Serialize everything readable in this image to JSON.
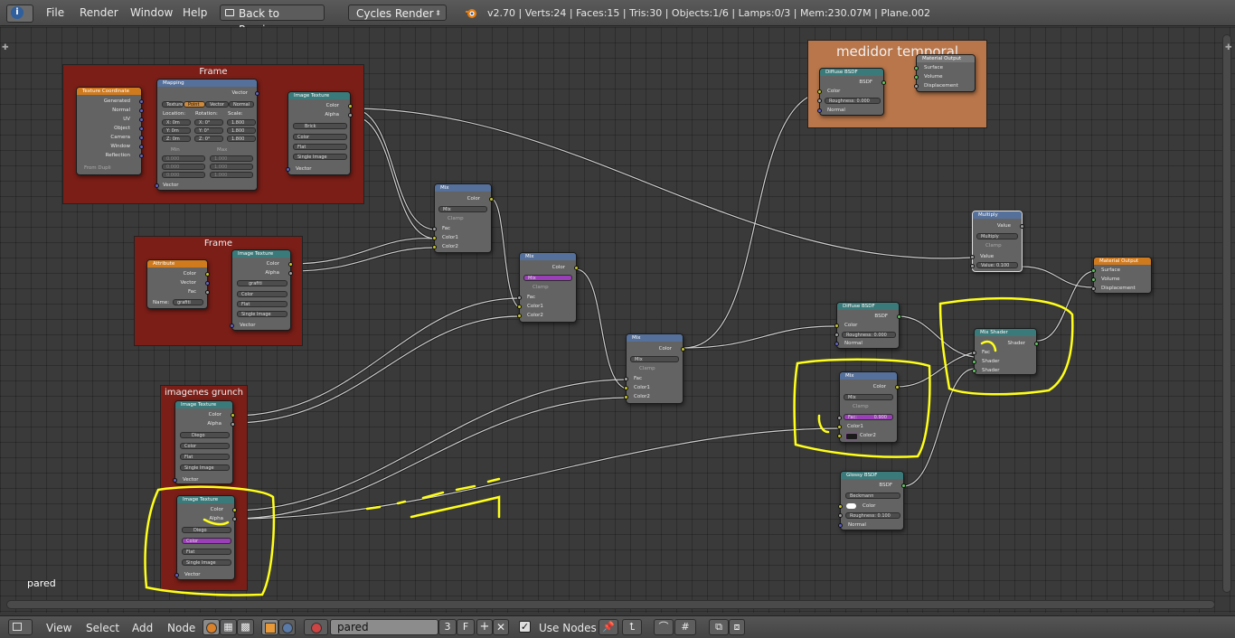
{
  "header": {
    "menus": [
      "File",
      "Render",
      "Window",
      "Help"
    ],
    "back_button": "Back to Previous",
    "engine": "Cycles Render",
    "status": "v2.70 | Verts:24 | Faces:15 | Tris:30 | Objects:1/6 | Lamps:0/3 | Mem:230.07M | Plane.002"
  },
  "editor": {
    "material_label": "pared",
    "frames": [
      {
        "title": "Frame"
      },
      {
        "title": "Frame"
      },
      {
        "title": "imagenes grunch"
      },
      {
        "title": "medidor temporal"
      }
    ],
    "nodes": {
      "texcoord": {
        "title": "Texture Coordinate",
        "outputs": [
          "Generated",
          "Normal",
          "UV",
          "Object",
          "Camera",
          "Window",
          "Reflection"
        ],
        "from_dupli": "From Dupli"
      },
      "mapping": {
        "title": "Mapping",
        "out": "Vector",
        "tabs": [
          "Texture",
          "Point",
          "Vector",
          "Normal"
        ],
        "loc": "Location:",
        "rot": "Rotation:",
        "scale": "Scale:",
        "locs": [
          "X: 0m",
          "Y: 0m",
          "Z: 0m"
        ],
        "rots": [
          "X: 0°",
          "Y: 0°",
          "Z: 0°"
        ],
        "scales": [
          "1.800",
          "1.800",
          "1.800"
        ],
        "min": "Min",
        "max": "Max",
        "mins": [
          "0.000",
          "0.000",
          "0.000"
        ],
        "maxs": [
          "1.000",
          "1.000",
          "1.000"
        ],
        "in": "Vector"
      },
      "imgtex": {
        "title": "Image Texture",
        "color": "Color",
        "alpha": "Alpha",
        "img": "Brick",
        "opt1": "Color",
        "opt2": "Flat",
        "opt3": "Single Image",
        "vector": "Vector"
      },
      "attribute": {
        "title": "Attribute",
        "outputs": [
          "Color",
          "Vector",
          "Fac"
        ],
        "name_label": "Name:",
        "name_val": "grafiti"
      },
      "imgtex2": {
        "title": "Image Texture",
        "color": "Color",
        "alpha": "Alpha",
        "img": "grafiti",
        "opt1": "Color",
        "opt2": "Flat",
        "opt3": "Single Image",
        "vector": "Vector"
      },
      "imgtex3": {
        "title": "Image Texture",
        "color": "Color",
        "alpha": "Alpha",
        "img": "Diego",
        "opt1": "Color",
        "opt2": "Flat",
        "opt3": "Single Image",
        "vector": "Vector"
      },
      "imgtex4": {
        "title": "Image Texture",
        "color": "Color",
        "alpha": "Alpha",
        "img": "Diego",
        "opt1": "Color",
        "opt2": "Flat",
        "opt3": "Single Image",
        "vector": "Vector"
      },
      "mix1": {
        "title": "Mix",
        "out": "Color",
        "mode": "Mix",
        "clamp": "Clamp",
        "fac": "Fac",
        "c1": "Color1",
        "c2": "Color2"
      },
      "mix2": {
        "title": "Mix",
        "out": "Color",
        "mode": "Mix",
        "clamp": "Clamp",
        "fac": "Fac",
        "c1": "Color1",
        "c2": "Color2"
      },
      "mix3": {
        "title": "Mix",
        "out": "Color",
        "mode": "Mix",
        "clamp": "Clamp",
        "fac": "Fac",
        "c1": "Color1",
        "c2": "Color2"
      },
      "mix4": {
        "title": "Mix",
        "out": "Color",
        "mode": "Mix",
        "clamp": "Clamp",
        "fac": "Fac:",
        "fac_val": "0.900",
        "c1": "Color1",
        "c2": "Color2"
      },
      "diffuse1": {
        "title": "Diffuse BSDF",
        "out": "BSDF",
        "color": "Color",
        "rough": "Roughness: 0.000",
        "normal": "Normal"
      },
      "diffuse2": {
        "title": "Diffuse BSDF",
        "out": "BSDF",
        "color": "Color",
        "rough": "Roughness: 0.000",
        "normal": "Normal"
      },
      "glossy": {
        "title": "Glossy BSDF",
        "out": "BSDF",
        "dist": "Beckmann",
        "color": "Color",
        "rough": "Roughness: 0.100",
        "normal": "Normal"
      },
      "mixshader": {
        "title": "Mix Shader",
        "out": "Shader",
        "fac": "Fac",
        "s1": "Shader",
        "s2": "Shader"
      },
      "multiply": {
        "title": "Multiply",
        "out": "Value",
        "mode": "Multiply",
        "clamp": "Clamp",
        "val": "Value",
        "val2": "Value: 0.100"
      },
      "matout1": {
        "title": "Material Output",
        "surface": "Surface",
        "volume": "Volume",
        "disp": "Displacement"
      },
      "matout2": {
        "title": "Material Output",
        "surface": "Surface",
        "volume": "Volume",
        "disp": "Displacement"
      }
    }
  },
  "footer": {
    "menus": [
      "View",
      "Select",
      "Add",
      "Node"
    ],
    "material_name": "pared",
    "users": "3",
    "fake": "F",
    "use_nodes": "Use Nodes"
  }
}
